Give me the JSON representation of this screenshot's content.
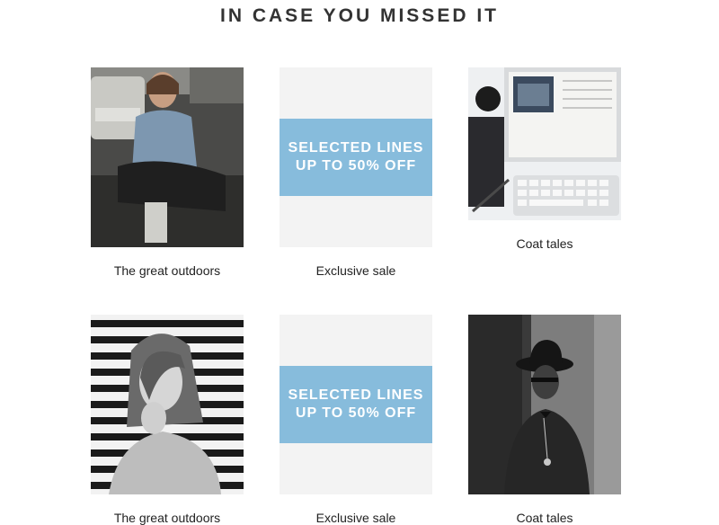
{
  "section": {
    "title": "IN CASE YOU MISSED IT"
  },
  "rows": [
    {
      "cards": [
        {
          "caption": "The great outdoors",
          "image": "woman-sitting-on-street-photo"
        },
        {
          "caption": "Exclusive sale",
          "banner": {
            "line1": "SELECTED LINES",
            "line2": "UP TO 50% OFF"
          }
        },
        {
          "caption": "Coat tales",
          "image": "desk-with-magazine-keyboard-photo"
        }
      ]
    },
    {
      "cards": [
        {
          "caption": "The great outdoors",
          "image": "woman-portrait-bw-photo"
        },
        {
          "caption": "Exclusive sale",
          "banner": {
            "line1": "SELECTED LINES",
            "line2": "UP TO 50% OFF"
          }
        },
        {
          "caption": "Coat tales",
          "image": "man-in-hat-bw-photo"
        }
      ]
    }
  ],
  "colors": {
    "banner": "#87bcdc",
    "placeholder": "#f3f3f3",
    "text": "#333333"
  }
}
